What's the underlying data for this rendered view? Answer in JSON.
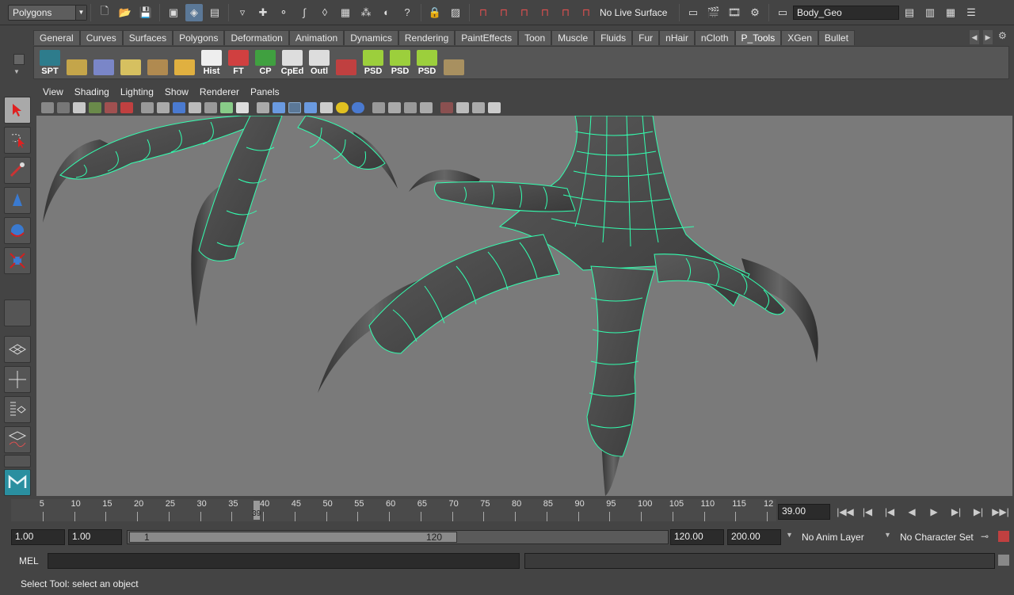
{
  "status_line": {
    "menu_set": "Polygons",
    "live_surface": "No Live Surface",
    "object_field": "Body_Geo"
  },
  "shelf": {
    "tabs": [
      "General",
      "Curves",
      "Surfaces",
      "Polygons",
      "Deformation",
      "Animation",
      "Dynamics",
      "Rendering",
      "PaintEffects",
      "Toon",
      "Muscle",
      "Fluids",
      "Fur",
      "nHair",
      "nCloth",
      "P_Tools",
      "XGen",
      "Bullet"
    ],
    "active_tab": "P_Tools",
    "buttons": [
      {
        "label": "SPT",
        "icon": "spt-icon",
        "color": "#2e7c8c"
      },
      {
        "label": "",
        "icon": "lattice-points-icon",
        "color": "#c4a54a"
      },
      {
        "label": "",
        "icon": "plane-blue-icon",
        "color": "#7a86c8"
      },
      {
        "label": "",
        "icon": "uv-grid-icon",
        "color": "#d6c060"
      },
      {
        "label": "",
        "icon": "cube-flat-icon",
        "color": "#b08a50"
      },
      {
        "label": "",
        "icon": "grid-deform-icon",
        "color": "#e0b040"
      },
      {
        "label": "Hist",
        "icon": "history-icon",
        "color": "#eeeeee"
      },
      {
        "label": "FT",
        "icon": "freeze-transform-icon",
        "color": "#d04040"
      },
      {
        "label": "CP",
        "icon": "center-pivot-icon",
        "color": "#40a040"
      },
      {
        "label": "CpEd",
        "icon": "component-editor-icon",
        "color": "#dddddd"
      },
      {
        "label": "Outl",
        "icon": "outliner-icon",
        "color": "#dddddd"
      },
      {
        "label": "",
        "icon": "paint-brush-icon",
        "color": "#c04040"
      },
      {
        "label": "PSD",
        "icon": "psd-green-icon",
        "color": "#9ccf3c"
      },
      {
        "label": "PSD",
        "icon": "psd-green-icon",
        "color": "#9ccf3c"
      },
      {
        "label": "PSD",
        "icon": "psd-green-icon",
        "color": "#9ccf3c"
      },
      {
        "label": "",
        "icon": "globe-icon",
        "color": "#a89060"
      }
    ]
  },
  "viewport": {
    "menus": [
      "View",
      "Shading",
      "Lighting",
      "Show",
      "Renderer",
      "Panels"
    ]
  },
  "time_slider": {
    "tick_labels": [
      "5",
      "10",
      "15",
      "20",
      "25",
      "30",
      "35",
      "40",
      "45",
      "50",
      "55",
      "60",
      "65",
      "70",
      "75",
      "80",
      "85",
      "90",
      "95",
      "100",
      "105",
      "110",
      "115",
      "12"
    ],
    "playhead_label": "39",
    "current_frame": "39.00"
  },
  "range_slider": {
    "anim_start": "1.00",
    "range_start": "1.00",
    "range_bar_start": "1",
    "range_bar_end": "120",
    "range_end": "120.00",
    "anim_end": "200.00",
    "anim_layer": "No Anim Layer",
    "character_set": "No Character Set"
  },
  "command_line": {
    "label": "MEL",
    "value": ""
  },
  "help_line": "Select Tool: select an object",
  "colors": {
    "wireframe": "#33ffb0",
    "mesh": "#4b4b4b",
    "viewport_bg": "#7a7a7a",
    "selection_blue": "#5b7897"
  }
}
